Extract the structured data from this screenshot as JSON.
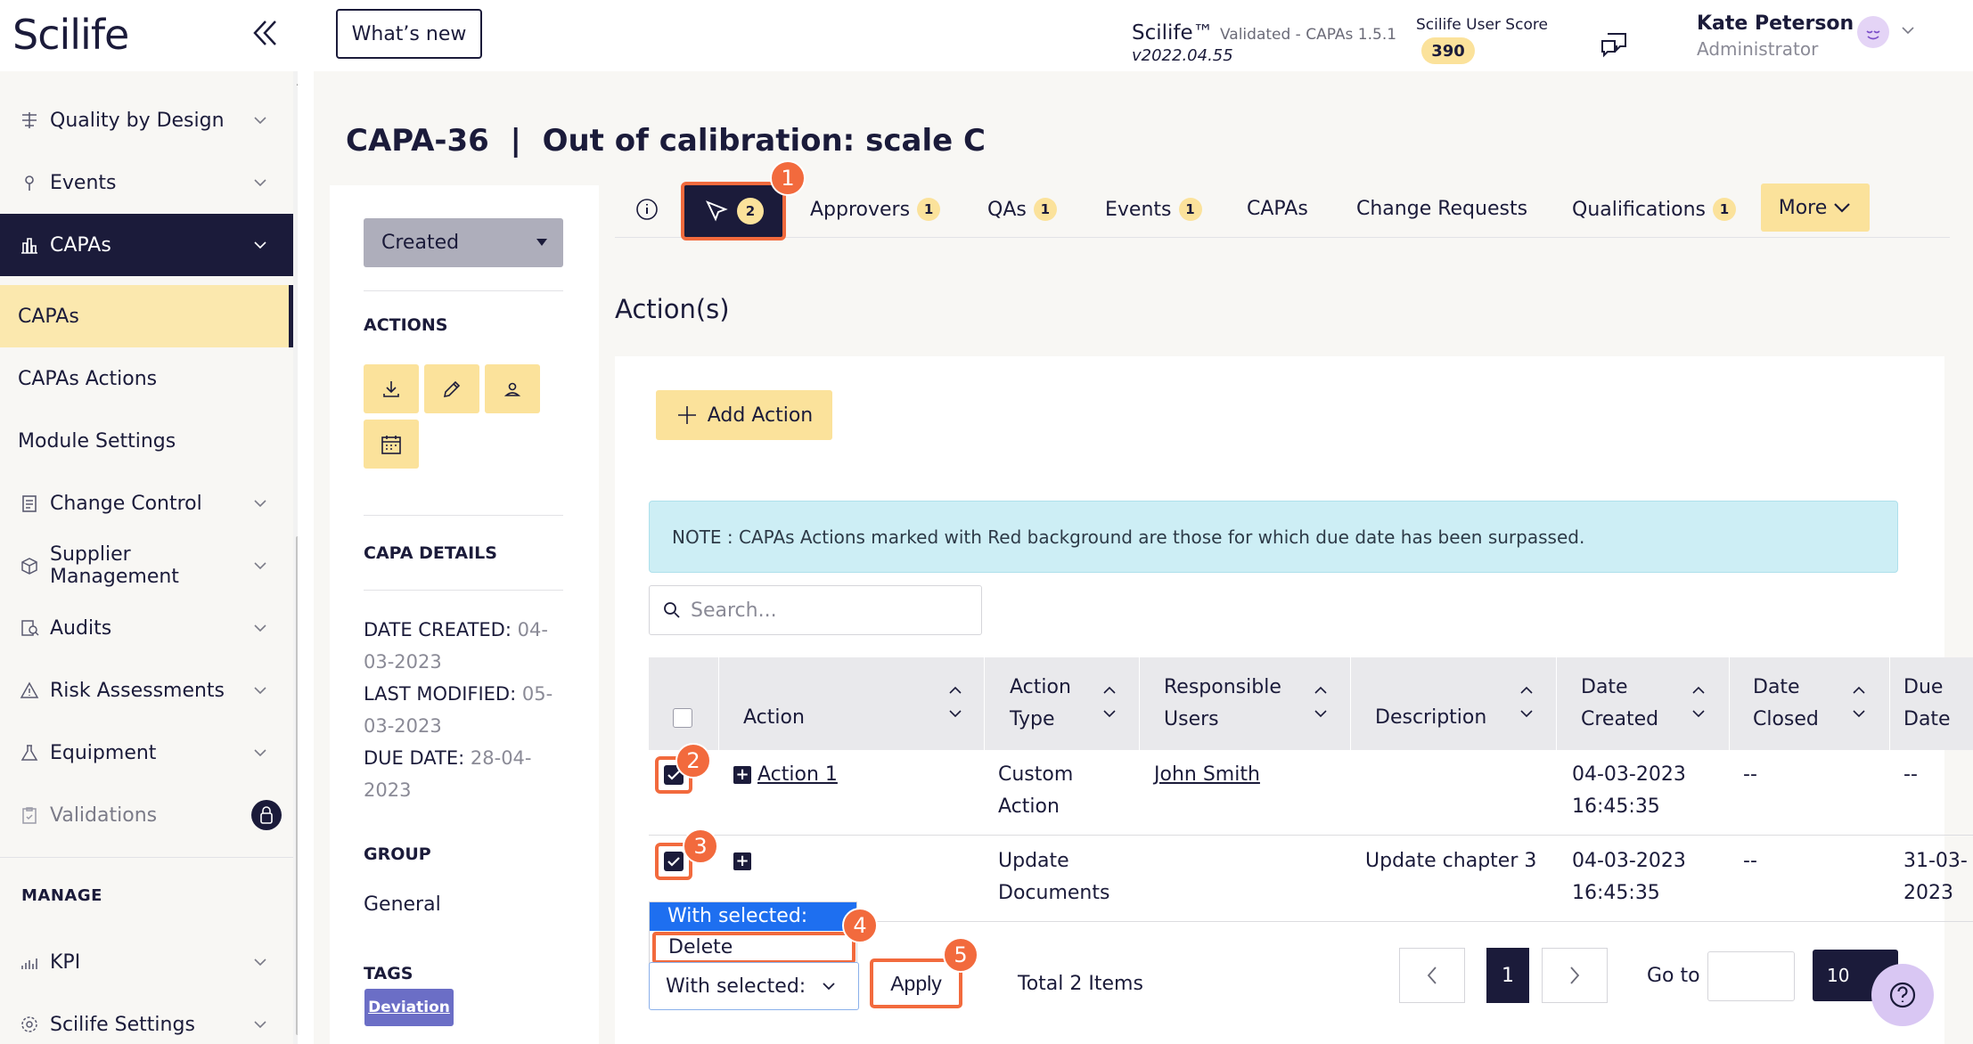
{
  "app": {
    "logo": "Scilife",
    "whats_new": "What’s new",
    "name": "Scilife™",
    "validated": "Validated - CAPAs 1.5.1",
    "version": "v2022.04.55",
    "score_label": "Scilife User Score",
    "score": "390"
  },
  "user": {
    "name": "Kate Peterson",
    "role": "Administrator"
  },
  "sidebar": {
    "items": [
      {
        "label": "Quality by Design",
        "icon": "quality-icon"
      },
      {
        "label": "Events",
        "icon": "pin-icon"
      },
      {
        "label": "CAPAs",
        "icon": "capa-icon"
      },
      {
        "label": "Change Control",
        "icon": "change-icon"
      },
      {
        "label": "Supplier Management",
        "icon": "supplier-icon"
      },
      {
        "label": "Audits",
        "icon": "audit-icon"
      },
      {
        "label": "Risk Assessments",
        "icon": "warning-icon"
      },
      {
        "label": "Equipment",
        "icon": "flask-icon"
      },
      {
        "label": "Validations",
        "icon": "clipboard-icon"
      }
    ],
    "sub": [
      "CAPAs",
      "CAPAs Actions",
      "Module Settings"
    ],
    "manage": "MANAGE",
    "manage_items": [
      {
        "label": "KPI"
      },
      {
        "label": "Scilife Settings"
      }
    ]
  },
  "page": {
    "title": "CAPA-36  |  Out of calibration: scale C",
    "status": "Created",
    "actions_heading": "ACTIONS",
    "details_heading": "CAPA DETAILS",
    "date_created_lbl": "DATE CREATED:",
    "date_created": "04-03-2023",
    "last_modified_lbl": "LAST MODIFIED:",
    "last_modified": "05-03-2023",
    "due_date_lbl": "DUE DATE:",
    "due_date": "28-04-2023",
    "group_heading": "GROUP",
    "group": "General",
    "tags_heading": "TAGS",
    "tag": "Deviation"
  },
  "tabs": [
    {
      "label": "",
      "badge": "2"
    },
    {
      "label": "Approvers",
      "badge": "1"
    },
    {
      "label": "QAs",
      "badge": "1"
    },
    {
      "label": "Events",
      "badge": "1"
    },
    {
      "label": "CAPAs",
      "badge": ""
    },
    {
      "label": "Change Requests",
      "badge": ""
    },
    {
      "label": "Qualifications",
      "badge": "1"
    },
    {
      "label": "More",
      "badge": ""
    }
  ],
  "panel": {
    "heading": "Action(s)",
    "add_action": "Add Action",
    "note": "NOTE : CAPAs Actions marked with Red background are those for which due date has been surpassed.",
    "search_placeholder": "Search..."
  },
  "table": {
    "headers": [
      "Action",
      "Action Type",
      "Responsible Users",
      "Description",
      "Date Created",
      "Date Closed",
      "Due Date"
    ],
    "rows": [
      {
        "action": "Action 1",
        "type": "Custom Action",
        "users": "John Smith",
        "description": "",
        "created": "04-03-2023 16:45:35",
        "closed": "--",
        "due": "--"
      },
      {
        "action": "",
        "type": "Update Documents",
        "users": "",
        "description": "Update chapter 3",
        "created": "04-03-2023 16:45:35",
        "closed": "--",
        "due": "31-03-2023"
      }
    ]
  },
  "bulk": {
    "options": [
      "With selected:",
      "Delete"
    ],
    "selected": "With selected:",
    "apply": "Apply",
    "total": "Total 2 Items"
  },
  "pagination": {
    "current": "1",
    "goto": "Go to",
    "per_page": "10"
  },
  "annotations": [
    "1",
    "2",
    "3",
    "4",
    "5"
  ],
  "colors": {
    "navy": "#1b1b3a",
    "accent": "#fbe29b",
    "highlight": "#f26a3d",
    "tag": "#6b6ec6"
  }
}
